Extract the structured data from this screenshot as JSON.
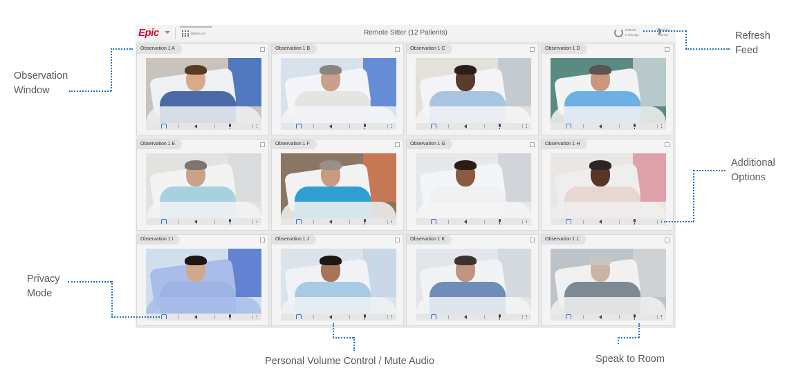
{
  "app": {
    "logo": "Epic",
    "watch_list_label": "Watch List",
    "title": "Remote Sitter (12 Patients)",
    "refresh_label": "Refresh",
    "refresh_time": "0 min ago",
    "theme_label_1": "Change",
    "theme_label_2": "Theme"
  },
  "tiles": [
    {
      "label": "Observation 1 A",
      "scene": {
        "bg": "#c8c3bc",
        "accent": "#2a5fc0",
        "bed": "#eef0f3",
        "skin": "#d9a98a",
        "hair": "#5a3a22",
        "gown": "#4b6aa8"
      }
    },
    {
      "label": "Observation 1 B",
      "scene": {
        "bg": "#d8e2ec",
        "accent": "#3f6fd0",
        "bed": "#f3f5f8",
        "skin": "#caa08a",
        "hair": "#8a8580",
        "gown": "#e4e4e2"
      }
    },
    {
      "label": "Observation 1 C",
      "scene": {
        "bg": "#e4e0da",
        "accent": "#b9c4cc",
        "bed": "#f4f4f6",
        "skin": "#5b3b2e",
        "hair": "#2a1f1a",
        "gown": "#a9c4e0"
      }
    },
    {
      "label": "Observation 1 D",
      "scene": {
        "bg": "#5b8a80",
        "accent": "#d8dee4",
        "bed": "#f2f3f5",
        "skin": "#c9977d",
        "hair": "#5b5450",
        "gown": "#6db0e6"
      }
    },
    {
      "label": "Observation 1 E",
      "scene": {
        "bg": "#e4e2df",
        "accent": "#d6d8dc",
        "bed": "#f3f3f4",
        "skin": "#caa288",
        "hair": "#7d7670",
        "gown": "#a6d1de"
      }
    },
    {
      "label": "Observation 1 F",
      "scene": {
        "bg": "#8a7662",
        "accent": "#d97952",
        "bed": "#f2f2f2",
        "skin": "#c89a7e",
        "hair": "#9a9088",
        "gown": "#2e9fd1"
      }
    },
    {
      "label": "Observation 1 G",
      "scene": {
        "bg": "#e6e9ec",
        "accent": "#c9ced3",
        "bed": "#f4f5f6",
        "skin": "#8a5a40",
        "hair": "#2a1d18",
        "gown": "#eef0f2"
      }
    },
    {
      "label": "Observation 1 H",
      "scene": {
        "bg": "#e9e6e4",
        "accent": "#d98a99",
        "bed": "#eeeeee",
        "skin": "#5a3628",
        "hair": "#2b2624",
        "gown": "#e7d6d2"
      }
    },
    {
      "label": "Observation 1 I",
      "scene": {
        "bg": "#cfe0ec",
        "accent": "#3f63c8",
        "bed": "#a9bdea",
        "skin": "#d2a88c",
        "hair": "#1e1714",
        "gown": "#9cb3e4"
      }
    },
    {
      "label": "Observation 1 J",
      "scene": {
        "bg": "#dde3ea",
        "accent": "#c0d4e6",
        "bed": "#f0f2f5",
        "skin": "#a87458",
        "hair": "#1c1614",
        "gown": "#a7cbe4"
      }
    },
    {
      "label": "Observation 1 K",
      "scene": {
        "bg": "#e2e6ea",
        "accent": "#d0d6dc",
        "bed": "#f2f3f5",
        "skin": "#bd9580",
        "hair": "#3a3330",
        "gown": "#6d8eb8"
      }
    },
    {
      "label": "Observation 1 L",
      "scene": {
        "bg": "#bdc3c8",
        "accent": "#d4d7da",
        "bed": "#f1f1f1",
        "skin": "#cdb3a4",
        "hair": "#c8c6c4",
        "gown": "#7d8a94"
      }
    }
  ],
  "controls": {
    "privacy": "privacy-mode",
    "volume": "mute-audio",
    "speak": "speak-to-room",
    "more": "additional-options"
  },
  "callouts": {
    "observation_window": [
      "Observation",
      "Window"
    ],
    "refresh_feed": [
      "Refresh",
      "Feed"
    ],
    "additional_options": [
      "Additional",
      "Options"
    ],
    "privacy_mode": [
      "Privacy",
      "Mode"
    ],
    "volume": "Personal Volume Control / Mute Audio",
    "speak": "Speak to Room"
  },
  "colors": {
    "accent_callout": "#1e73be",
    "epic_red": "#c8102e",
    "privacy_blue": "#2e6fd3"
  }
}
